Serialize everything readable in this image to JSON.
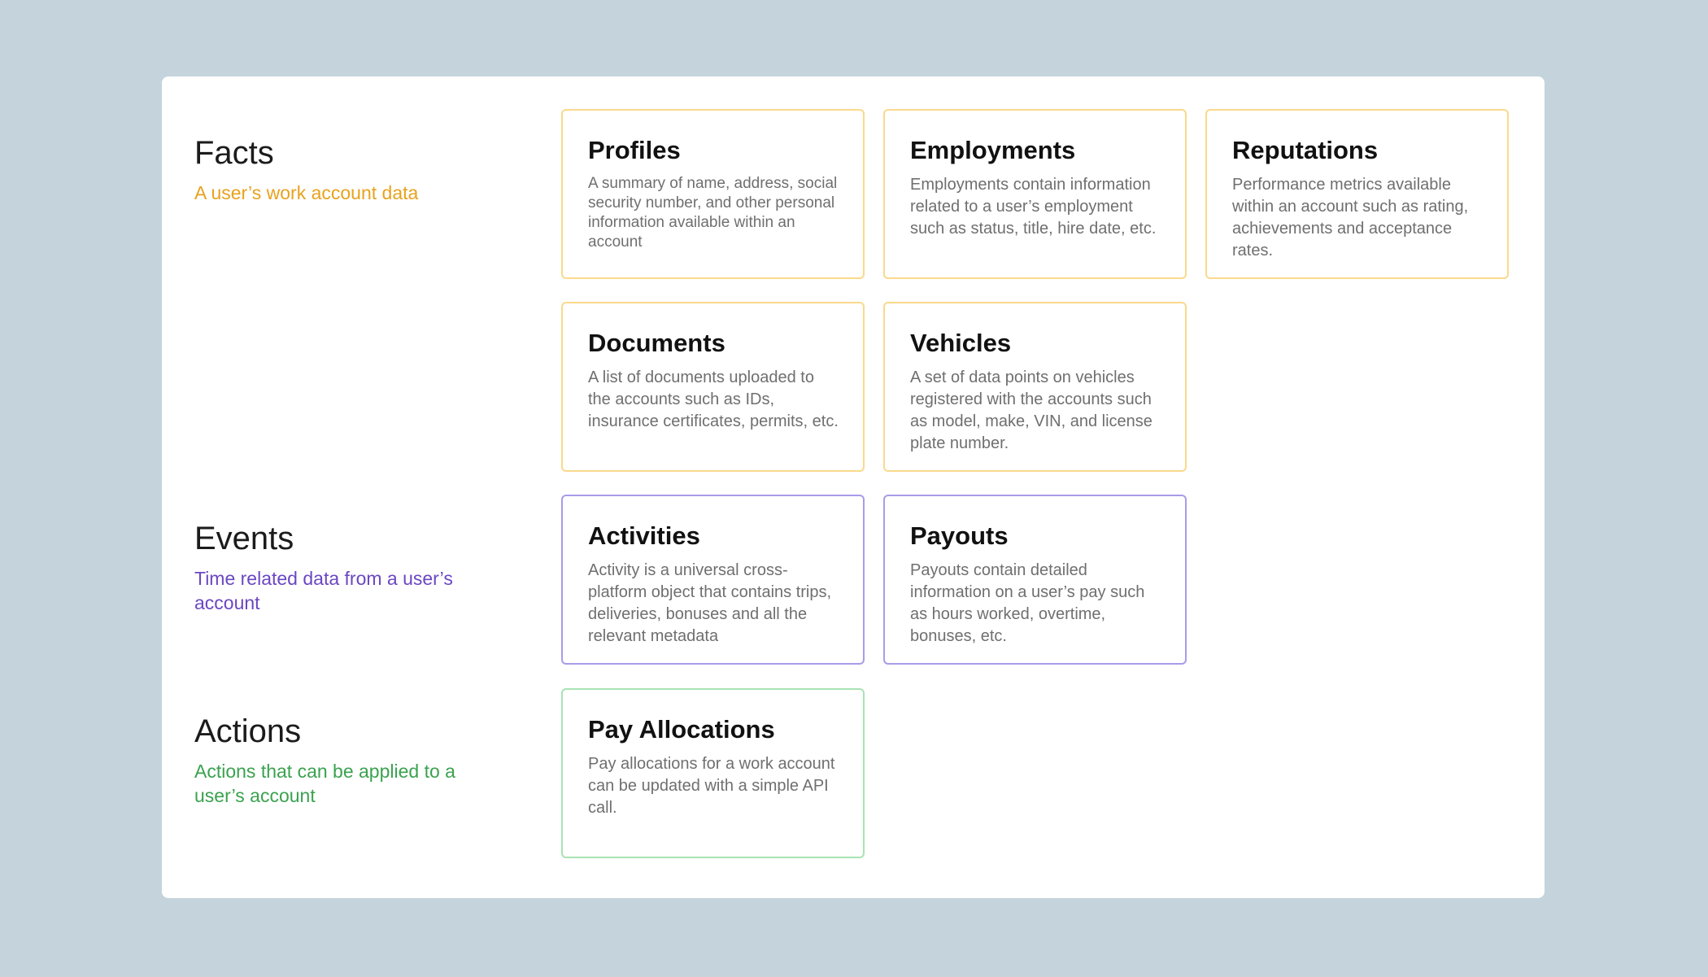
{
  "sections": {
    "facts": {
      "title": "Facts",
      "subtitle": "A user’s work account data",
      "color": "#e8a21e"
    },
    "events": {
      "title": "Events",
      "subtitle": "Time related data from a user’s account",
      "color": "#6b47c2"
    },
    "actions": {
      "title": "Actions",
      "subtitle": "Actions that can be applied to a user’s account",
      "color": "#3aa24f"
    }
  },
  "cards": {
    "profiles": {
      "title": "Profiles",
      "description": "A summary of name, address, social security number, and other personal information available within an account"
    },
    "employments": {
      "title": "Employments",
      "description": "Employments contain information related to a user’s employment such as status, title, hire date, etc."
    },
    "reputations": {
      "title": "Reputations",
      "description": "Performance metrics available within an account such as rating, achievements and acceptance rates."
    },
    "documents": {
      "title": "Documents",
      "description": "A list of documents uploaded to the accounts such as IDs, insurance certificates, permits, etc."
    },
    "vehicles": {
      "title": "Vehicles",
      "description": "A set of data points on vehicles registered with the accounts such as model, make, VIN, and license plate number."
    },
    "activities": {
      "title": "Activities",
      "description": "Activity is a universal cross-platform object that contains trips, deliveries, bonuses and all the relevant metadata"
    },
    "payouts": {
      "title": "Payouts",
      "description": "Payouts contain detailed information on a user’s pay such as hours worked, overtime, bonuses, etc."
    },
    "pay_allocations": {
      "title": "Pay Allocations",
      "description": "Pay allocations for a work account can be updated with a simple API call."
    }
  },
  "colors": {
    "background": "#c5d3dc",
    "panel": "#ffffff",
    "fact_border": "#fad98b",
    "event_border": "#a99be8",
    "action_border": "#a8e3b3"
  }
}
